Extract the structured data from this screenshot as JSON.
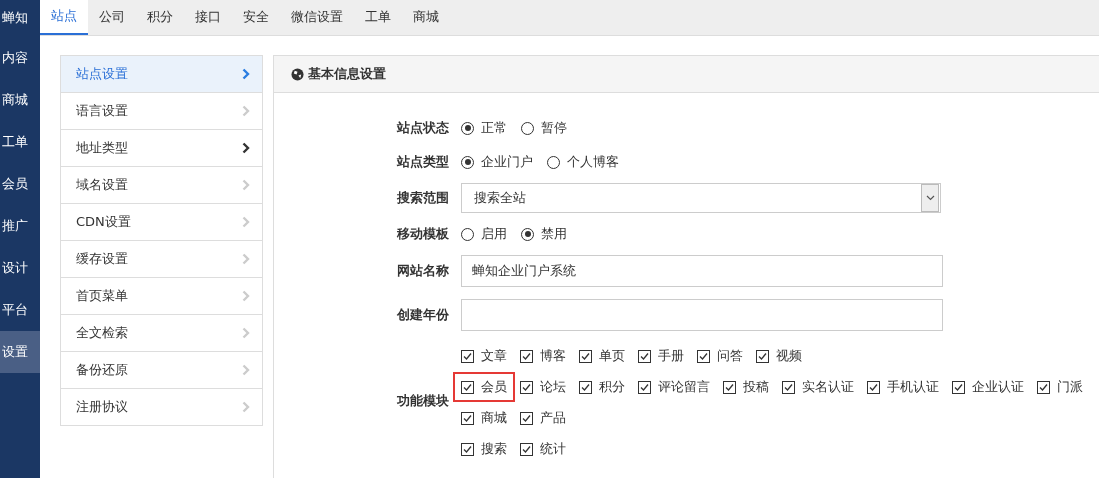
{
  "left_nav": [
    {
      "label": "蝉知",
      "selected": false
    },
    {
      "label": "内容",
      "selected": false
    },
    {
      "label": "商城",
      "selected": false
    },
    {
      "label": "工单",
      "selected": false
    },
    {
      "label": "会员",
      "selected": false
    },
    {
      "label": "推广",
      "selected": false
    },
    {
      "label": "设计",
      "selected": false
    },
    {
      "label": "平台",
      "selected": false
    },
    {
      "label": "设置",
      "selected": true
    }
  ],
  "tabs": [
    {
      "label": "站点",
      "selected": true
    },
    {
      "label": "公司",
      "selected": false
    },
    {
      "label": "积分",
      "selected": false
    },
    {
      "label": "接口",
      "selected": false
    },
    {
      "label": "安全",
      "selected": false
    },
    {
      "label": "微信设置",
      "selected": false
    },
    {
      "label": "工单",
      "selected": false
    },
    {
      "label": "商城",
      "selected": false
    }
  ],
  "side_menu": [
    {
      "label": "站点设置",
      "selected": true,
      "hovered": false
    },
    {
      "label": "语言设置",
      "selected": false,
      "hovered": false
    },
    {
      "label": "地址类型",
      "selected": false,
      "hovered": true
    },
    {
      "label": "域名设置",
      "selected": false,
      "hovered": false
    },
    {
      "label": "CDN设置",
      "selected": false,
      "hovered": false
    },
    {
      "label": "缓存设置",
      "selected": false,
      "hovered": false
    },
    {
      "label": "首页菜单",
      "selected": false,
      "hovered": false
    },
    {
      "label": "全文检索",
      "selected": false,
      "hovered": false
    },
    {
      "label": "备份还原",
      "selected": false,
      "hovered": false
    },
    {
      "label": "注册协议",
      "selected": false,
      "hovered": false
    }
  ],
  "panel": {
    "title": "基本信息设置",
    "fields": [
      {
        "kind": "radio",
        "label": "站点状态",
        "options": [
          {
            "label": "正常",
            "selected": true
          },
          {
            "label": "暂停",
            "selected": false
          }
        ]
      },
      {
        "kind": "radio",
        "label": "站点类型",
        "options": [
          {
            "label": "企业门户",
            "selected": true
          },
          {
            "label": "个人博客",
            "selected": false
          }
        ]
      },
      {
        "kind": "select",
        "label": "搜索范围",
        "value": "搜索全站"
      },
      {
        "kind": "radio",
        "label": "移动模板",
        "options": [
          {
            "label": "启用",
            "selected": false
          },
          {
            "label": "禁用",
            "selected": true
          }
        ]
      },
      {
        "kind": "text",
        "label": "网站名称",
        "value": "蝉知企业门户系统"
      },
      {
        "kind": "text",
        "label": "创建年份"
      },
      {
        "kind": "checkboxes",
        "label": "功能模块",
        "rows": [
          [
            {
              "label": "文章",
              "checked": true,
              "highlighted": false
            },
            {
              "label": "博客",
              "checked": true,
              "highlighted": false
            },
            {
              "label": "单页",
              "checked": true,
              "highlighted": false
            },
            {
              "label": "手册",
              "checked": true,
              "highlighted": false
            },
            {
              "label": "问答",
              "checked": true,
              "highlighted": false
            },
            {
              "label": "视频",
              "checked": true,
              "highlighted": false
            }
          ],
          [
            {
              "label": "会员",
              "checked": true,
              "highlighted": true
            },
            {
              "label": "论坛",
              "checked": true,
              "highlighted": false
            },
            {
              "label": "积分",
              "checked": true,
              "highlighted": false
            },
            {
              "label": "评论留言",
              "checked": true,
              "highlighted": false
            },
            {
              "label": "投稿",
              "checked": true,
              "highlighted": false
            },
            {
              "label": "实名认证",
              "checked": true,
              "highlighted": false
            },
            {
              "label": "手机认证",
              "checked": true,
              "highlighted": false
            },
            {
              "label": "企业认证",
              "checked": true,
              "highlighted": false
            },
            {
              "label": "门派",
              "checked": true,
              "highlighted": false
            }
          ],
          [
            {
              "label": "商城",
              "checked": true,
              "highlighted": false
            },
            {
              "label": "产品",
              "checked": true,
              "highlighted": false
            }
          ],
          [
            {
              "label": "搜索",
              "checked": true,
              "highlighted": false
            },
            {
              "label": "统计",
              "checked": true,
              "highlighted": false
            }
          ]
        ]
      }
    ]
  }
}
